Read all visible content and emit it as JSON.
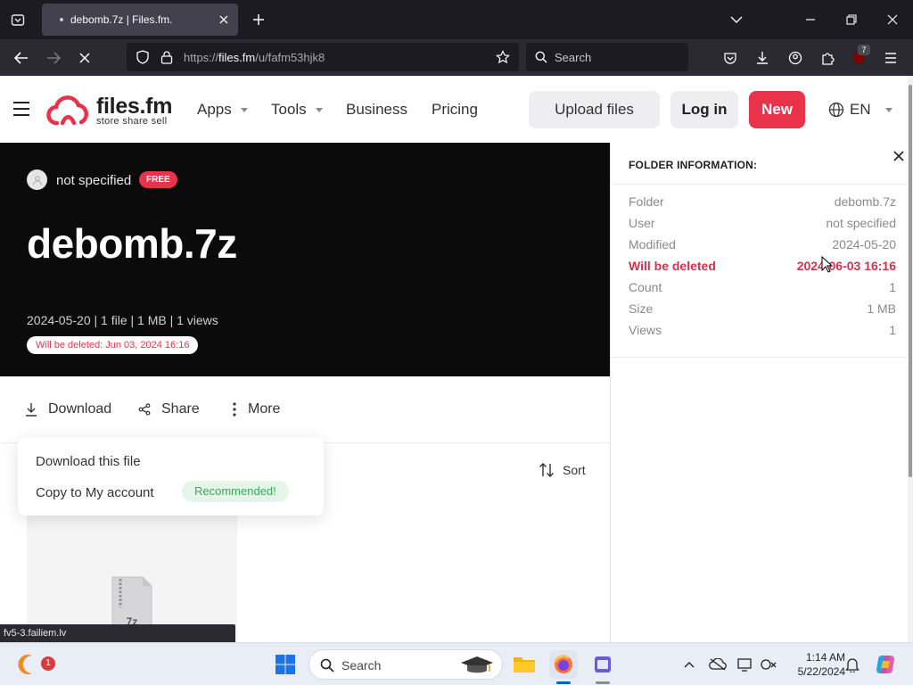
{
  "browser": {
    "tab_title": "debomb.7z | Files.fm.",
    "url_prefix": "https://",
    "url_host": "files.fm",
    "url_path": "/u/fafm53hjk8",
    "search_placeholder": "Search",
    "extension_badge": "7",
    "status_url": "fv5-3.failiem.lv"
  },
  "site": {
    "logo_name": "files.fm",
    "logo_tagline": "store share sell",
    "menu": {
      "apps": "Apps",
      "tools": "Tools",
      "business": "Business",
      "pricing": "Pricing"
    },
    "upload_label": "Upload files",
    "login_label": "Log in",
    "new_label": "New",
    "language": "EN"
  },
  "hero": {
    "owner": "not specified",
    "plan_badge": "FREE",
    "title": "debomb.7z",
    "meta": "2024-05-20 | 1 file | 1 MB | 1 views",
    "deletion_notice": "Will be deleted: Jun 03, 2024 16:16"
  },
  "actions": {
    "download": "Download",
    "share": "Share",
    "more": "More",
    "sort": "Sort"
  },
  "dropdown": {
    "download_file": "Download this file",
    "copy_to_account": "Copy to My account",
    "recommended": "Recommended!"
  },
  "file": {
    "ext_label": "7z"
  },
  "folder_info": {
    "heading": "FOLDER INFORMATION:",
    "rows": [
      {
        "key": "Folder",
        "value": "debomb.7z"
      },
      {
        "key": "User",
        "value": "not specified"
      },
      {
        "key": "Modified",
        "value": "2024-05-20"
      },
      {
        "key": "Will be deleted",
        "value": "2024-06-03 16:16"
      },
      {
        "key": "Count",
        "value": "1"
      },
      {
        "key": "Size",
        "value": "1 MB"
      },
      {
        "key": "Views",
        "value": "1"
      }
    ]
  },
  "taskbar": {
    "search_placeholder": "Search",
    "notification_count": "1",
    "time": "1:14 AM",
    "date": "5/22/2024"
  },
  "colors": {
    "brand_red": "#e8334a",
    "hero_bg": "#0b0b0b",
    "success_green": "#3aaa55"
  }
}
